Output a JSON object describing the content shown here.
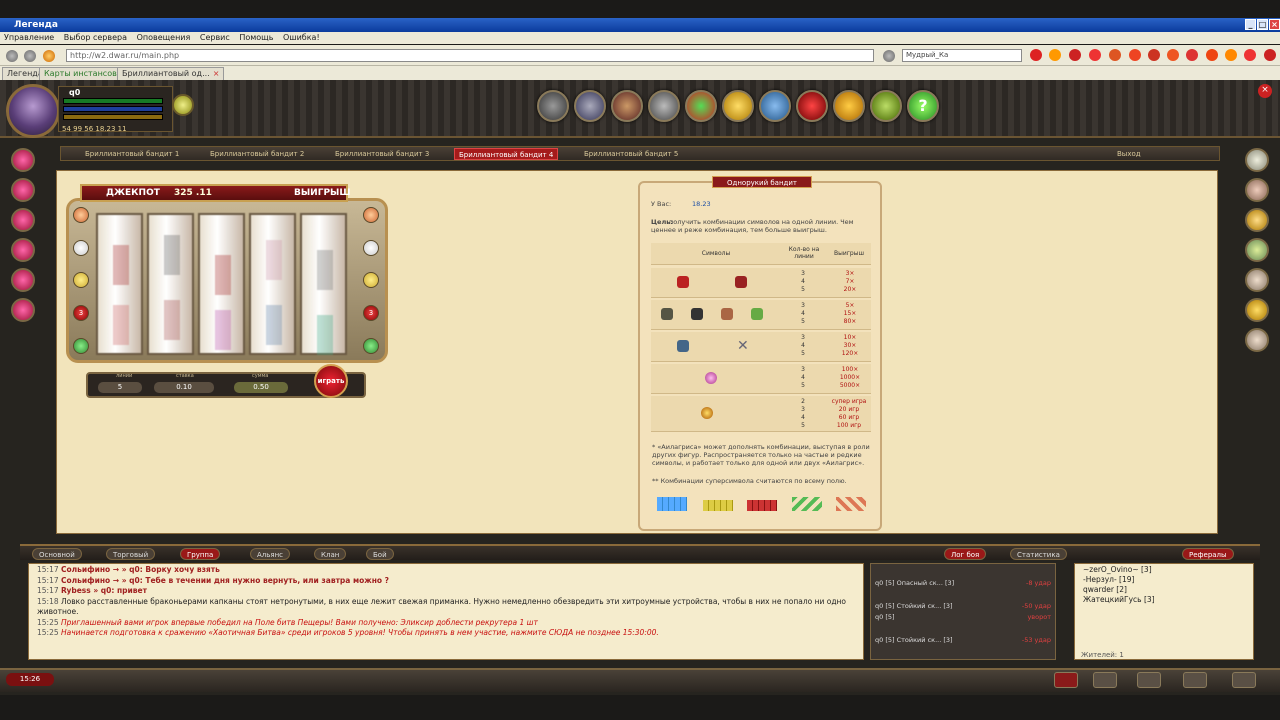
{
  "window": {
    "title": "Легенда"
  },
  "menu": [
    "Управление",
    "Выбор сервера",
    "Оповещения",
    "Сервис",
    "Помощь",
    "Ошибка!"
  ],
  "address": {
    "url": "http://w2.dwar.ru/main.php",
    "nick": "Мудрый_Ка"
  },
  "browser_tabs": [
    {
      "label": "Легенда"
    },
    {
      "label": "Карты инстансов"
    },
    {
      "label": "Бриллиантовый од..."
    }
  ],
  "player": {
    "name": "q0",
    "stats": "54  99  56  18.23  11"
  },
  "content_tabs": [
    "Бриллиантовый бандит 1",
    "Бриллиантовый бандит 2",
    "Бриллиантовый бандит 3",
    "Бриллиантовый бандит 4",
    "Бриллиантовый бандит 5"
  ],
  "content_exit": "Выход",
  "slot": {
    "jackpot_label": "ДЖЕКПОТ",
    "jackpot_value": "325 .11",
    "win_label": "ВЫИГРЫШ",
    "lines_label": "линии",
    "stake_label": "ставка",
    "sum_label": "сумма",
    "lines_value": "5",
    "stake_value": "0.10",
    "sum_value": "0.50",
    "spin_label": "играть",
    "lamp_left": "3",
    "lamp_right": "3"
  },
  "info": {
    "title": "Однорукий бандит",
    "balance_label": "У Вас:",
    "balance": "18.23",
    "goal_bold": "Цель:",
    "goal": "получить комбинации символов на одной линии. Чем ценнее и реже комбинация, тем больше выигрыш.",
    "col_symbols": "Символы",
    "col_count": "Кол-во на линии",
    "col_win": "Выигрыш",
    "rows": [
      {
        "counts": [
          "3",
          "4",
          "5"
        ],
        "pays": [
          "3×",
          "7×",
          "20×"
        ]
      },
      {
        "counts": [
          "3",
          "4",
          "5"
        ],
        "pays": [
          "5×",
          "15×",
          "80×"
        ]
      },
      {
        "counts": [
          "3",
          "4",
          "5"
        ],
        "pays": [
          "10×",
          "30×",
          "120×"
        ]
      },
      {
        "counts": [
          "3",
          "4",
          "5"
        ],
        "pays": [
          "100×",
          "1000×",
          "5000×"
        ]
      },
      {
        "counts": [
          "2",
          "3",
          "4",
          "5"
        ],
        "pays": [
          "супер игра",
          "20 игр",
          "60 игр",
          "100 игр"
        ]
      }
    ],
    "note1": "* «Аилагриса» может дополнять комбинации, выступая в роли других фигур. Распространяется только на частые и редкие символы, и работает только для одной или двух «Аилагрис».",
    "note2": "** Комбинации суперсимвола считаются по всему полю."
  },
  "chat_tabs": [
    "Основной",
    "Торговый",
    "Группа",
    "Альянс",
    "Клан",
    "Бой"
  ],
  "log_tabs": [
    "Лог боя",
    "Статистика"
  ],
  "referals": "Рефералы",
  "chat": [
    {
      "time": "15:17",
      "text": "Сольифино → » q0: Ворку хочу взять"
    },
    {
      "time": "15:17",
      "text": "Сольифино → » q0: Тебе в течении дня нужно вернуть, или завтра можно ?"
    },
    {
      "time": "15:17",
      "text": "Rybess » q0: привет"
    },
    {
      "time": "15:18",
      "text": "Ловко расставленные браконьерами капканы стоят нетронутыми, в них еще лежит свежая приманка. Нужно немедленно обезвредить эти хитроумные устройства, чтобы в них не попало ни одно животное."
    },
    {
      "time": "15:25",
      "text": "Приглашенный вами игрок впервые победил на Поле битв Пещеры! Вами получено: Эликсир доблести рекрутера 1 шт"
    },
    {
      "time": "15:25",
      "text": "Начинается подготовка к сражению «Хаотичная Битва» среди игроков 5 уровня! Чтобы принять в нем участие, нажмите СЮДА не позднее 15:30:00."
    }
  ],
  "log": [
    {
      "text": "q0 [5]  Опасный ск... [3]",
      "value": "-8 удар"
    },
    {
      "text": "q0 [5]  Стойкий ск... [3]",
      "value": "-50 удар"
    },
    {
      "text": "q0 [5]",
      "value": "уворот"
    },
    {
      "text": "q0 [5]  Стойкий ск... [3]",
      "value": "-53 удар"
    }
  ],
  "users": [
    {
      "text": "~zerO_Ovino~ [3]"
    },
    {
      "text": "-Нерзул- [19]"
    },
    {
      "text": "qwarder [2]"
    },
    {
      "text": "ЖатецкийГусь [3]"
    }
  ],
  "users_footer": "Жителей: 1",
  "clock": "15:26"
}
